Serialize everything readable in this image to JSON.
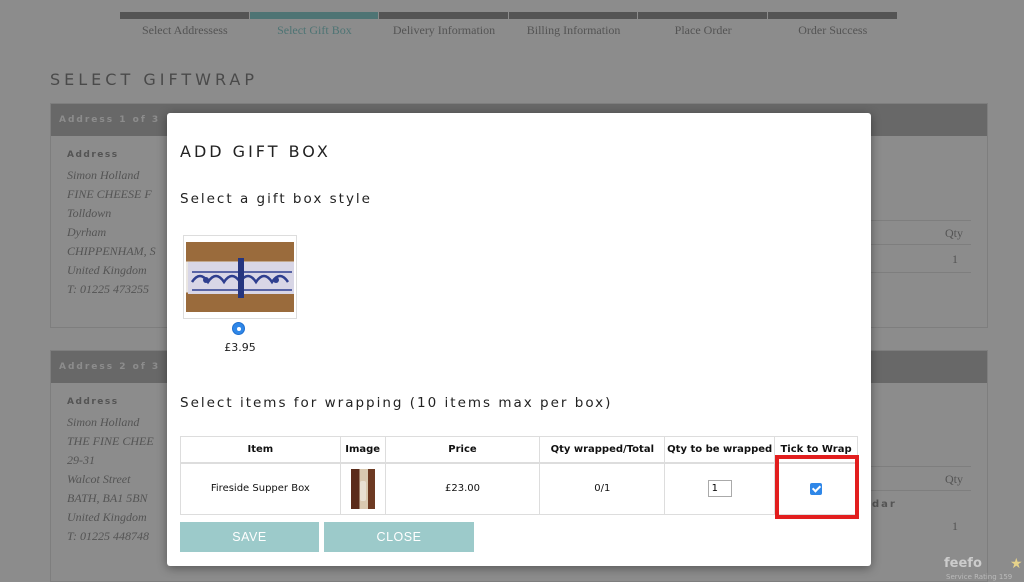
{
  "steps": [
    {
      "label": "Select Addressess"
    },
    {
      "label": "Select Gift Box"
    },
    {
      "label": "Delivery Information"
    },
    {
      "label": "Billing Information"
    },
    {
      "label": "Place Order"
    },
    {
      "label": "Order Success"
    }
  ],
  "page_title": "SELECT GIFTWRAP",
  "addresses": [
    {
      "heading": "Address 1 of 3",
      "label": "Address",
      "lines": [
        "Simon Holland",
        "FINE CHEESE F",
        "Tolldown",
        "Dyrham",
        "CHIPPENHAM, S",
        "United Kingdom",
        "T: 01225 473255"
      ],
      "qty_header": "Qty",
      "qty_value": "1"
    },
    {
      "heading": "Address 2 of 3",
      "label": "Address",
      "lines": [
        "Simon Holland",
        "THE FINE CHEE",
        "29-31",
        "Walcot Street",
        "BATH, BA1 5BN",
        "United Kingdom",
        "T: 01225 448748"
      ],
      "qty_header": "Qty",
      "qty_value": "1",
      "extra_text": "dar"
    }
  ],
  "modal": {
    "title": "ADD GIFT BOX",
    "style_label": "Select a gift box style",
    "gift_box": {
      "price": "£3.95",
      "selected": true
    },
    "items_label": "Select items for wrapping (10 items max per box)",
    "table": {
      "headers": [
        "Item",
        "Image",
        "Price",
        "Qty wrapped/Total",
        "Qty to be wrapped",
        "Tick to Wrap"
      ],
      "rows": [
        {
          "item": "Fireside Supper Box",
          "price": "£23.00",
          "qty_wrapped_total": "0/1",
          "qty_to_wrap": "1",
          "tick": true
        }
      ]
    },
    "save_label": "SAVE",
    "close_label": "CLOSE"
  },
  "feefo": {
    "logo": "feefo",
    "sub": "Service Rating  159"
  },
  "colors": {
    "accent": "#9ccaca",
    "active_step": "#8ed3d3",
    "radio": "#2f87e8",
    "highlight": "#e21e1e"
  }
}
